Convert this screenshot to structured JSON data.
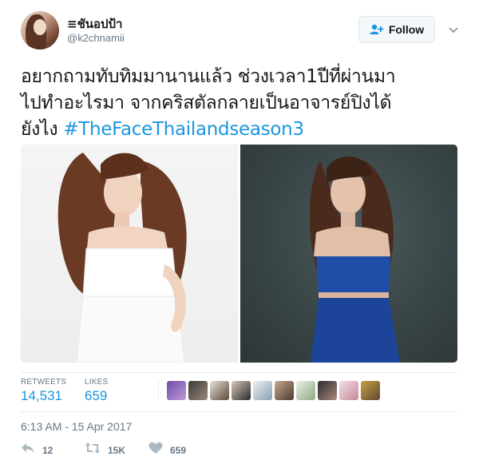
{
  "tweet": {
    "display_name": "≡ชันอปป้า",
    "handle": "@k2chnamii",
    "follow_label": "Follow",
    "text_line1": "อยากถามทับทิมมานานแล้ว ช่วงเวลา1ปีที่ผ่านมา",
    "text_line2": "ไปทำอะไรมา จากคริสตัลกลายเป็นอาจารย์ปิงได้",
    "text_line3": "ยังไง",
    "hashtag": "#TheFaceThailandseason3",
    "timestamp": "6:13 AM - 15 Apr 2017"
  },
  "stats": {
    "retweets_label": "RETWEETS",
    "retweets_value": "14,531",
    "likes_label": "LIKES",
    "likes_value": "659"
  },
  "likers": [
    "liker-1",
    "liker-2",
    "liker-3",
    "liker-4",
    "liker-5",
    "liker-6",
    "liker-7",
    "liker-8",
    "liker-9",
    "liker-10"
  ],
  "actions": {
    "reply_count": "12",
    "retweet_count": "15K",
    "like_count": "659"
  },
  "icons": {
    "follow": "follow-user-icon",
    "menu": "chevron-down-icon",
    "reply": "reply-icon",
    "retweet": "retweet-icon",
    "like": "heart-icon"
  },
  "colors": {
    "link": "#1b95e0",
    "muted": "#657786",
    "text": "#14171a",
    "border": "#e6ecf0"
  }
}
